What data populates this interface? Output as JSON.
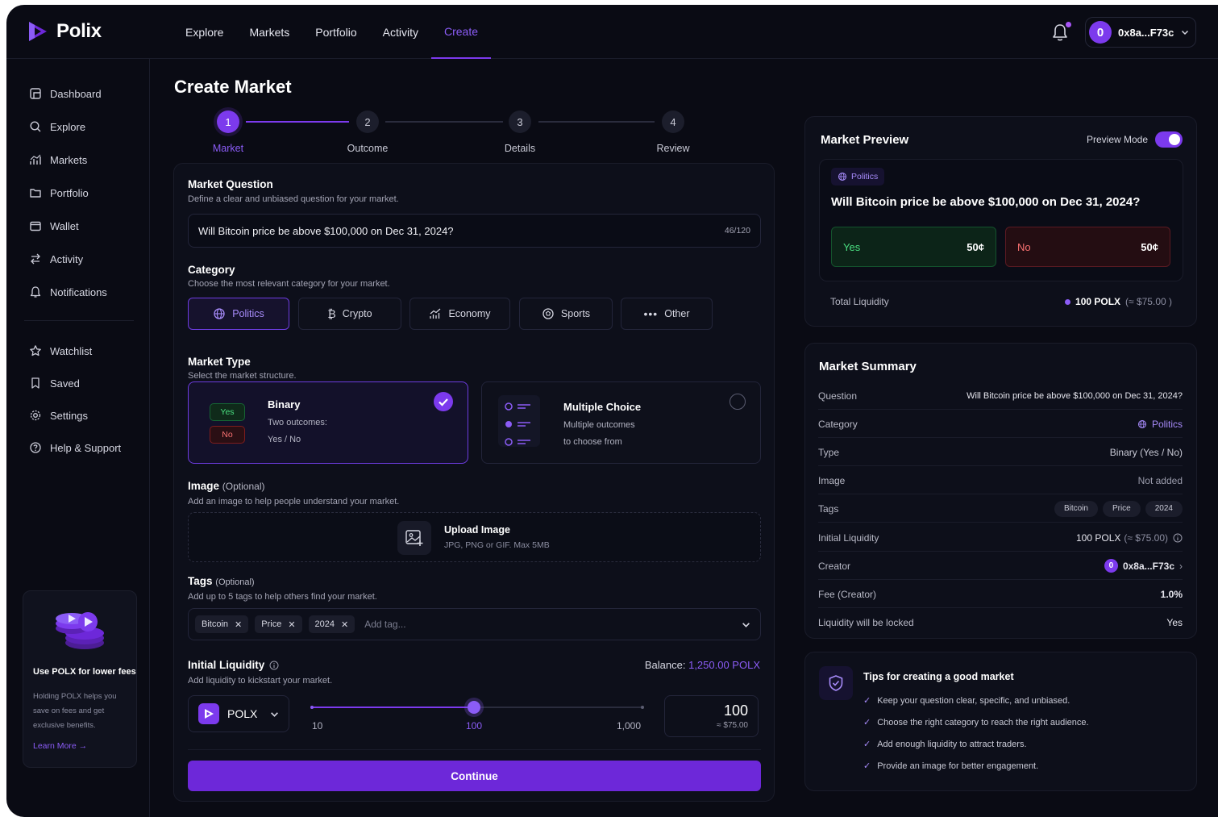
{
  "app": {
    "name": "Polix"
  },
  "nav": {
    "items": [
      "Explore",
      "Markets",
      "Portfolio",
      "Activity",
      "Create"
    ],
    "active": "Create"
  },
  "user": {
    "avatar_letter": "0",
    "address": "0x8a...F73c"
  },
  "sidebar": {
    "items": [
      {
        "label": "Dashboard",
        "icon": "dashboard-icon"
      },
      {
        "label": "Explore",
        "icon": "search-icon"
      },
      {
        "label": "Markets",
        "icon": "chart-icon"
      },
      {
        "label": "Portfolio",
        "icon": "folder-icon"
      },
      {
        "label": "Wallet",
        "icon": "wallet-icon"
      },
      {
        "label": "Activity",
        "icon": "arrows-icon"
      },
      {
        "label": "Notifications",
        "icon": "bell-icon"
      },
      {
        "label": "Watchlist",
        "icon": "star-icon"
      },
      {
        "label": "Saved",
        "icon": "bookmark-icon"
      },
      {
        "label": "Settings",
        "icon": "gear-icon"
      },
      {
        "label": "Help & Support",
        "icon": "help-icon"
      }
    ],
    "promo": {
      "title": "Use POLX for lower fees",
      "text": "Holding POLX helps you save on fees and get exclusive benefits.",
      "link": "Learn More"
    }
  },
  "page": {
    "title": "Create Market"
  },
  "steps": [
    {
      "num": "1",
      "label": "Market"
    },
    {
      "num": "2",
      "label": "Outcome"
    },
    {
      "num": "3",
      "label": "Details"
    },
    {
      "num": "4",
      "label": "Review"
    }
  ],
  "form": {
    "question": {
      "title": "Market Question",
      "sub": "Define a clear and unbiased question for your market.",
      "value": "Will Bitcoin price be above $100,000 on Dec 31, 2024?",
      "count": "46/120"
    },
    "category": {
      "title": "Category",
      "sub": "Choose the most relevant category for your market.",
      "options": [
        "Politics",
        "Crypto",
        "Economy",
        "Sports",
        "Other"
      ],
      "selected": "Politics"
    },
    "market_type": {
      "title": "Market Type",
      "sub": "Select the market structure.",
      "binary": {
        "title": "Binary",
        "desc1": "Two outcomes:",
        "desc2": "Yes / No",
        "yes": "Yes",
        "no": "No"
      },
      "multiple": {
        "title": "Multiple Choice",
        "desc1": "Multiple outcomes",
        "desc2": "to choose from"
      }
    },
    "image": {
      "title": "Image",
      "optional": "(Optional)",
      "sub": "Add an image to help people understand your market.",
      "upload_label": "Upload Image",
      "upload_hint": "JPG, PNG or GIF. Max 5MB"
    },
    "tags": {
      "title": "Tags",
      "optional": "(Optional)",
      "sub": "Add up to 5 tags to help others find your market.",
      "chips": [
        "Bitcoin",
        "Price",
        "2024"
      ],
      "placeholder": "Add tag..."
    },
    "liquidity": {
      "title": "Initial Liquidity",
      "sub": "Add liquidity to kickstart your market.",
      "balance_label": "Balance:",
      "balance_value": "1,250.00 POLX",
      "token": "POLX",
      "slider_min": "10",
      "slider_value": "100",
      "slider_max": "1,000",
      "slider_fraction": 0.49,
      "amount": "100",
      "amount_usd": "≈ $75.00"
    },
    "continue_label": "Continue"
  },
  "preview": {
    "title": "Market Preview",
    "mode_label": "Preview Mode",
    "mode_on": true,
    "category": "Politics",
    "question": "Will Bitcoin price be above $100,000 on Dec 31, 2024?",
    "yes_label": "Yes",
    "yes_price": "50¢",
    "no_label": "No",
    "no_price": "50¢",
    "liquidity_label": "Total Liquidity",
    "liquidity_value": "100 POLX",
    "liquidity_usd": "(≈ $75.00 )"
  },
  "summary": {
    "title": "Market Summary",
    "question_label": "Question",
    "question_value": "Will Bitcoin price be above $100,000 on Dec 31, 2024?",
    "category_label": "Category",
    "category_value": "Politics",
    "type_label": "Type",
    "type_value": "Binary (Yes / No)",
    "image_label": "Image",
    "image_value": "Not added",
    "tags_label": "Tags",
    "tags": [
      "Bitcoin",
      "Price",
      "2024"
    ],
    "liquidity_label": "Initial Liquidity",
    "liquidity_value": "100 POLX",
    "liquidity_usd": "(≈ $75.00)",
    "creator_label": "Creator",
    "creator_avatar": "0",
    "creator_value": "0x8a...F73c",
    "fee_label": "Fee (Creator)",
    "fee_value": "1.0%",
    "locked_label": "Liquidity will be locked",
    "locked_value": "Yes"
  },
  "tips": {
    "title": "Tips for creating a good market",
    "items": [
      "Keep your question clear, specific, and unbiased.",
      "Choose the right category to reach the right audience.",
      "Add enough liquidity to attract traders.",
      "Provide an image for better engagement."
    ]
  },
  "colors": {
    "accent": "#7c3aed",
    "accent_text": "#8b5cf6",
    "yes": "#22c55e",
    "no": "#ef4444",
    "background": "#0a0b14"
  }
}
